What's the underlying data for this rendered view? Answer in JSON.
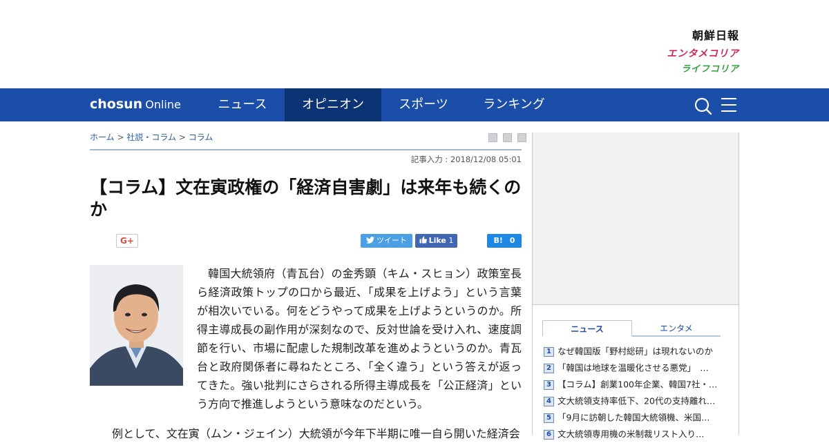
{
  "header": {
    "brands": [
      "朝鮮日報",
      "エンタメコリア",
      "ライフコリア"
    ]
  },
  "nav": {
    "logo_main": "chosun",
    "logo_sub": "Online",
    "items": [
      "ニュース",
      "オピニオン",
      "スポーツ",
      "ランキング"
    ],
    "active": "オピニオン"
  },
  "breadcrumb": {
    "home": "ホーム",
    "sep": ">",
    "section": "社説・コラム",
    "sub": "コラム"
  },
  "article": {
    "date": "記事入力 : 2018/12/08 05:01",
    "title": "【コラム】文在寅政権の「経済自害劇」は来年も続くのか",
    "body_p1": "韓国大統領府（青瓦台）の金秀顕（キム・スヒョン）政策室長ら経済政策トップの口から最近、「成果を上げよう」という言葉が相次いでいる。何をどうやって成果を上げようというのか。所得主導成長の副作用が深刻なので、反対世論を受け入れ、速度調節を行い、市場に配慮した規制改革を進めようというのか。青瓦台と政府関係者に尋ねたところ、「全く違う」という答えが返ってきた。強い批判にさらされる所得主導成長を「公正経済」という方向で推進しようという意味なのだという。",
    "body_p2": "例として、文在寅（ムン・ジェイン）大統領が今年下半期に唯一自ら開いた経済会"
  },
  "share": {
    "gplus": "G+",
    "tweet": "ツイート",
    "fb_like": "Like",
    "fb_count": "1",
    "hatena": "B!",
    "hatena_count": "0"
  },
  "sidebar": {
    "tabs": [
      "ニュース",
      "エンタメ"
    ],
    "ranking": [
      {
        "num": "1",
        "text": "なぜ韓国版「野村総研」は現れないのか"
      },
      {
        "num": "2",
        "text": "「韓国は地球を温暖化させる悪党」　…"
      },
      {
        "num": "3",
        "text": "【コラム】創業100年企業、韓国7社・…"
      },
      {
        "num": "4",
        "text": "文大統領支持率低下、20代の支持離れ…"
      },
      {
        "num": "5",
        "text": "「9月に訪朝した韓国大統領機、米国…"
      },
      {
        "num": "6",
        "text": "文大統領専用機の米制裁リスト入り…"
      }
    ]
  },
  "colors": {
    "nav_bg": "#1a4ea8",
    "nav_active": "#0c3474",
    "brand_enta": "#d0235a",
    "brand_life": "#2ea33c"
  }
}
